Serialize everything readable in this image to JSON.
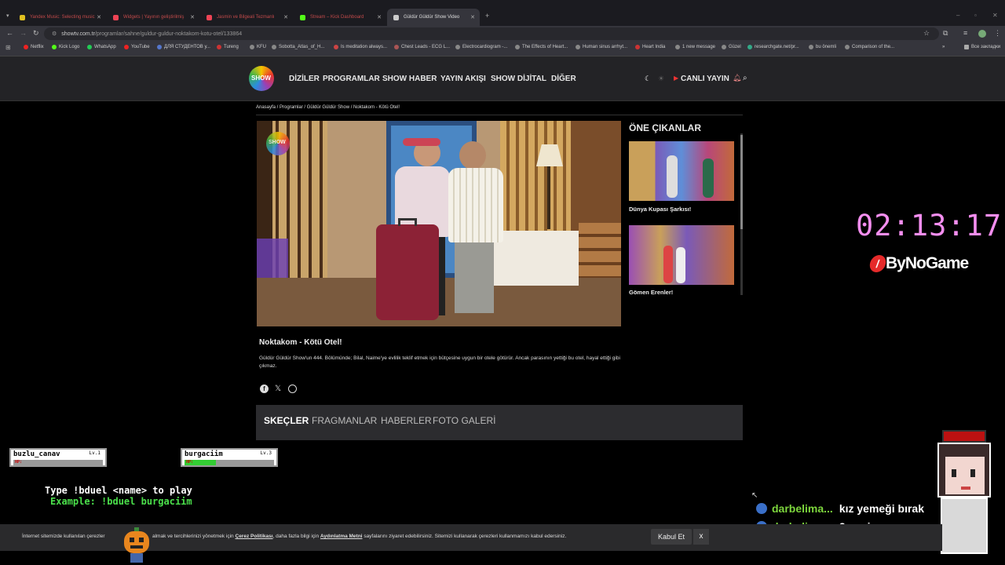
{
  "browser": {
    "tabs": [
      {
        "label": "Yandex Music: Selecting music",
        "color": "#e0c020"
      },
      {
        "label": "Widgets | Yayının geliştirilmiş",
        "color": "#e45"
      },
      {
        "label": "Jasmin ve Bilgeali Tezmanlı",
        "color": "#e45"
      },
      {
        "label": "Stream – Kick Dashboard",
        "color": "#53fc18"
      },
      {
        "label": "Güldür Güldür Show Video",
        "color": "#ccc"
      }
    ],
    "url_host": "showtv.com.tr",
    "url_path": "/programlar/sahne/guldur-guldur-noktakom-kotu-otel/133864",
    "bookmarks": [
      "Netflix",
      "Kick Logo",
      "WhatsApp",
      "YouTube",
      "ДЛЯ СТУДЕНТОВ у...",
      "Tureng",
      "KFU",
      "Sobotta_Atlas_of_H...",
      "Is meditation always...",
      "Chest Leads - ECG L...",
      "Electrocardiogram -...",
      "The Effects of Heart...",
      "Human sinus arrhyt...",
      "Heart India",
      "1 new message",
      "Güzel",
      "researchgate.net/pr...",
      "bu önemli",
      "Comparison of the..."
    ],
    "bookmarks_other": "Все закладки"
  },
  "site": {
    "logo": "SHOW",
    "nav": [
      "DİZİLER",
      "PROGRAMLAR",
      "SHOW HABER",
      "YAYIN AKIŞI",
      "SHOW DİJİTAL",
      "DİĞER"
    ],
    "live_label": "CANLI YAYIN"
  },
  "breadcrumb": "Anasayfa / Programlar / Güldür Güldür Show / Noktakom - Kötü Otel!",
  "video": {
    "watermark": "SHOW",
    "title": "Noktakom - Kötü Otel!",
    "description": "Güldür Güldür Show'un 444. Bölümünde; Bilal, Naime'ye evlilik teklif etmek için bütçesine uygun bir otele götürür. Ancak parasının yettiği bu otel, hayal ettiği gibi çıkmaz."
  },
  "sidebar": {
    "heading": "ÖNE ÇIKANLAR",
    "items": [
      {
        "title": "Dünya Kupası Şarkısı!"
      },
      {
        "title": "Gömen Erenler!"
      }
    ]
  },
  "content_tabs": [
    "SKEÇLER",
    "FRAGMANLAR",
    "HABERLER",
    "FOTO GALERİ"
  ],
  "overlay": {
    "timer": "02:13:17",
    "brand": "ByNoGame",
    "players": [
      {
        "name": "buzlu_canav",
        "level": "Lv.1",
        "hp_label": "HP:",
        "hp": 0
      },
      {
        "name": "burgaciim",
        "level": "Lv.3",
        "hp_label": "HP:",
        "hp": 0.35
      }
    ],
    "instruction": "Type !bduel <name> to play",
    "example": "Example: !bduel burgaciim",
    "chat": [
      {
        "user": "darbelima...",
        "message": "kız yemeği bırak"
      },
      {
        "user": "darbelima...",
        "message": "2 saniye"
      }
    ]
  },
  "cookie": {
    "text_1": "İnternet sitemizde kullanılan çerezler",
    "text_2": "almak ve tercihlerinizi yönetmek için",
    "link_1": "Çerez Politikası",
    "text_3": ", daha fazla bilgi için",
    "link_2": "Aydınlatma Metni",
    "text_4": "sayfalarını ziyaret edebilirsiniz. Sitemizi kullanarak çerezleri kullanmamızı kabul edersiniz.",
    "accept": "Kabul Et",
    "close": "x"
  },
  "colors": {
    "accent_pink": "#f58ef0",
    "chat_user": "#7dd63d",
    "live_red": "#e33"
  }
}
